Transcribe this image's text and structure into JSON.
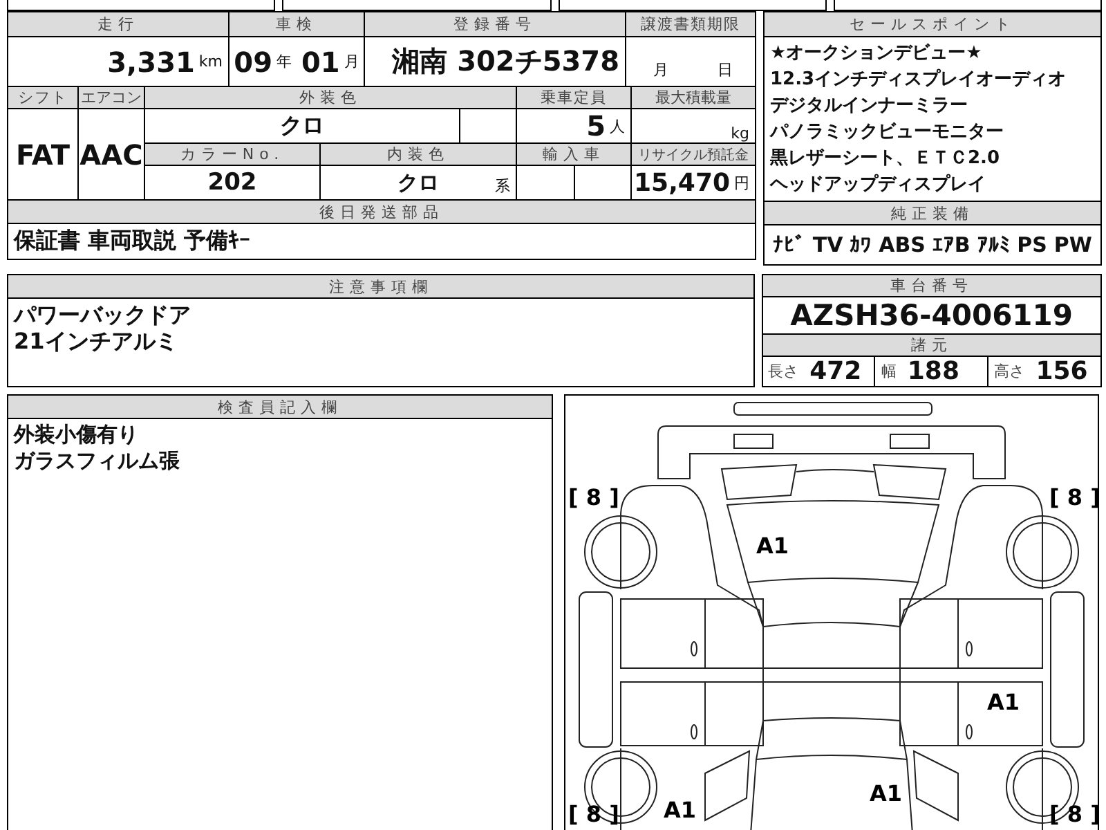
{
  "vehicle": {
    "mileage": {
      "label": "走行",
      "value": "3,331",
      "unit": "km"
    },
    "inspection": {
      "label": "車検",
      "year": "09",
      "year_unit": "年",
      "month": "01",
      "month_unit": "月"
    },
    "registration": {
      "label": "登録番号",
      "value": "湘南 302チ5378"
    },
    "transfer_deadline": {
      "label": "譲渡書類期限",
      "month_unit": "月",
      "day_unit": "日"
    },
    "shift": {
      "label": "シフト",
      "value": "FAT"
    },
    "air_conditioning": {
      "label": "エアコン",
      "value": "AAC"
    },
    "exterior_color": {
      "label": "外装色",
      "value": "クロ"
    },
    "capacity": {
      "label": "乗車定員",
      "value": "5",
      "unit": "人"
    },
    "max_load": {
      "label": "最大積載量",
      "unit": "kg"
    },
    "color_number": {
      "label": "カラーNo.",
      "value": "202"
    },
    "interior_color": {
      "label": "内装色",
      "value": "クロ",
      "suffix": "系"
    },
    "imported": {
      "label": "輸入車"
    },
    "recycling_deposit": {
      "label": "リサイクル預託金",
      "value": "15,470",
      "unit": "円"
    },
    "later_items": {
      "label": "後日発送部品",
      "value": "保証書 車両取説 予備ｷｰ"
    }
  },
  "sales_points": {
    "label": "セールスポイント",
    "lines": [
      "★オークションデビュー★",
      "12.3インチディスプレイオーディオ",
      "デジタルインナーミラー",
      "パノラミックビューモニター",
      "黒レザーシート、ＥＴＣ2.0",
      "ヘッドアップディスプレイ"
    ]
  },
  "equipment": {
    "label": "純正装備",
    "items": [
      "ﾅﾋﾞ",
      "TV",
      "ｶﾜ",
      "ABS",
      "ｴｱB",
      "ｱﾙﾐ",
      "PS",
      "PW"
    ]
  },
  "notes": {
    "label": "注意事項欄",
    "lines": [
      "パワーバックドア",
      "21インチアルミ"
    ]
  },
  "chassis": {
    "label": "車台番号",
    "value": "AZSH36-4006119"
  },
  "specs": {
    "label": "諸元",
    "items": [
      {
        "label": "長さ",
        "value": "472"
      },
      {
        "label": "幅",
        "value": "188"
      },
      {
        "label": "高さ",
        "value": "156"
      }
    ]
  },
  "inspector": {
    "label": "検査員記入欄",
    "lines": [
      "外装小傷有り",
      "ガラスフィルム張"
    ]
  },
  "diagram": {
    "tires": [
      "[ 8 ]",
      "[ 8 ]",
      "[ 8 ]",
      "[ 8 ]"
    ],
    "damages": [
      "A1",
      "A1",
      "A1",
      "A1"
    ]
  }
}
